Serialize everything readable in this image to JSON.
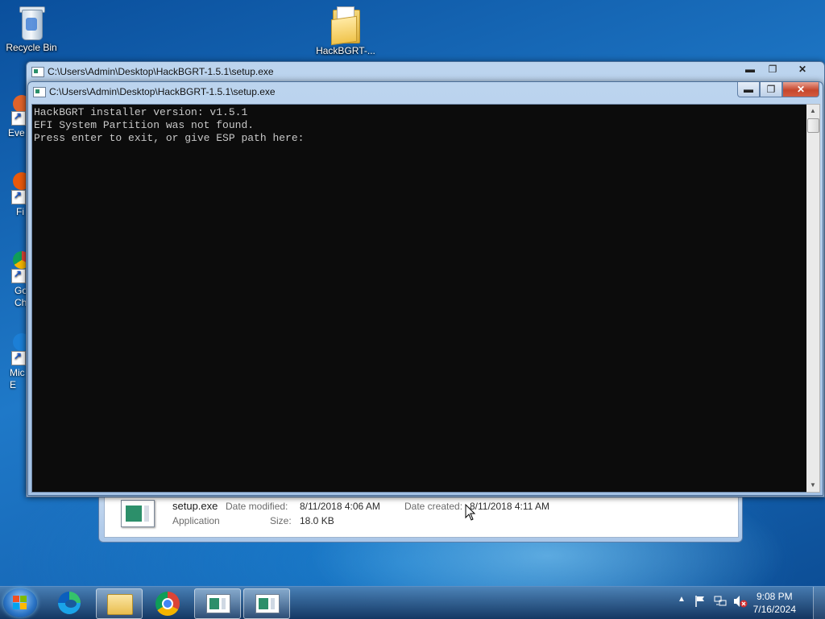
{
  "desktop": {
    "icons": [
      {
        "label": "Recycle Bin",
        "icon": "recycle-bin-icon"
      },
      {
        "label": "HackBGRT-...",
        "icon": "folder-icon"
      }
    ],
    "partial_shortcuts": [
      "Eve",
      "Fi",
      "Go Ch",
      "Mic E"
    ]
  },
  "explorer_details": {
    "file_name": "setup.exe",
    "file_type": "Application",
    "date_modified_label": "Date modified:",
    "date_modified_value": "8/11/2018 4:06 AM",
    "size_label": "Size:",
    "size_value": "18.0 KB",
    "date_created_label": "Date created:",
    "date_created_value": "8/11/2018 4:11 AM"
  },
  "back_window": {
    "title": "C:\\Users\\Admin\\Desktop\\HackBGRT-1.5.1\\setup.exe"
  },
  "console_window": {
    "title": "C:\\Users\\Admin\\Desktop\\HackBGRT-1.5.1\\setup.exe",
    "output": "HackBGRT installer version: v1.5.1\nEFI System Partition was not found.\nPress enter to exit, or give ESP path here:",
    "background_color": "#0c0c0c",
    "text_color": "#c8c8c8"
  },
  "window_controls": {
    "minimize": "▬",
    "maximize": "❐",
    "close": "✕"
  },
  "scrollbar": {
    "up": "▲",
    "down": "▼"
  },
  "taskbar": {
    "buttons": [
      {
        "name": "edge",
        "icon": "edge-icon"
      },
      {
        "name": "file-explorer",
        "icon": "folder-icon"
      },
      {
        "name": "chrome",
        "icon": "chrome-icon"
      },
      {
        "name": "setup-window-1",
        "icon": "app-window-icon"
      },
      {
        "name": "setup-window-2",
        "icon": "app-window-icon"
      }
    ],
    "tray_arrow": "▲",
    "time": "9:08 PM",
    "date": "7/16/2024"
  }
}
